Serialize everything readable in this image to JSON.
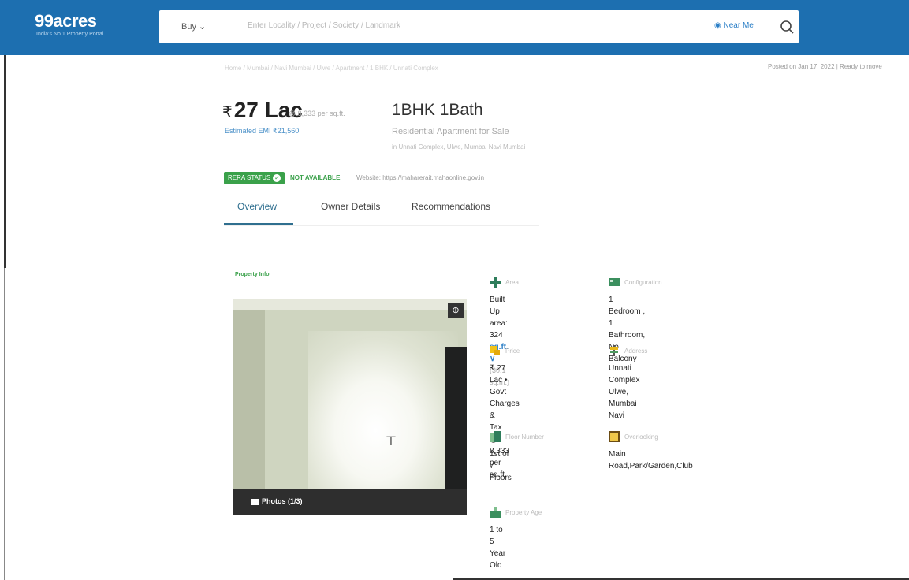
{
  "header": {
    "logo": "99acres",
    "logo_sub": "India's No.1 Property Portal",
    "buy_label": "Buy",
    "search_placeholder": "Enter Locality / Project / Society / Landmark",
    "near_me": "Near Me",
    "colors": {
      "header_bg": "#1d6fb0",
      "accent": "#3aa14a"
    }
  },
  "breadcrumb": "Home / Mumbai / Navi Mumbai / Ulwe / Apartment / 1 BHK / Unnati Complex",
  "posted": "Posted on Jan 17, 2022  |  Ready to move",
  "price": {
    "symbol": "₹",
    "value": "27 Lac",
    "per_sqft": "@ 8,333 per sq.ft.",
    "emi": "Estimated EMI ₹21,560"
  },
  "property": {
    "title": "1BHK 1Bath",
    "subtitle": "Residential Apartment for Sale",
    "address": "in Unnati Complex, Ulwe, Mumbai Navi Mumbai"
  },
  "rera": {
    "status_label": "RERA STATUS",
    "availability": "NOT AVAILABLE",
    "website": "Website: https://maharerait.mahaonline.gov.in"
  },
  "tabs": [
    "Overview",
    "Owner Details",
    "Recommendations"
  ],
  "photos": {
    "section_label": "Property Info",
    "count_label": "Photos (1/3)"
  },
  "details": {
    "area": {
      "label": "Area",
      "line1": "Built Up area: 324",
      "unit": "sq.ft. ∨",
      "line2": "(30.1 sq.m.)"
    },
    "configuration": {
      "label": "Configuration",
      "line1": "1 Bedroom , 1 Bathroom,",
      "line2": "No Balcony"
    },
    "price": {
      "label": "Price",
      "line1": "₹ 27 Lac • Govt Charges &",
      "line2": "Tax",
      "line3": "@ 8,333 per sq.ft."
    },
    "address": {
      "label": "Address",
      "line1": "Unnati Complex",
      "line2": "Ulwe, Mumbai Navi"
    },
    "floor": {
      "label": "Floor Number",
      "line1": "1st  of 7 Floors"
    },
    "overlooking": {
      "label": "Overlooking",
      "line1": "Main",
      "line2": "Road,Park/Garden,Club"
    },
    "age": {
      "label": "Property Age",
      "line1": "1 to 5 Year Old"
    }
  }
}
